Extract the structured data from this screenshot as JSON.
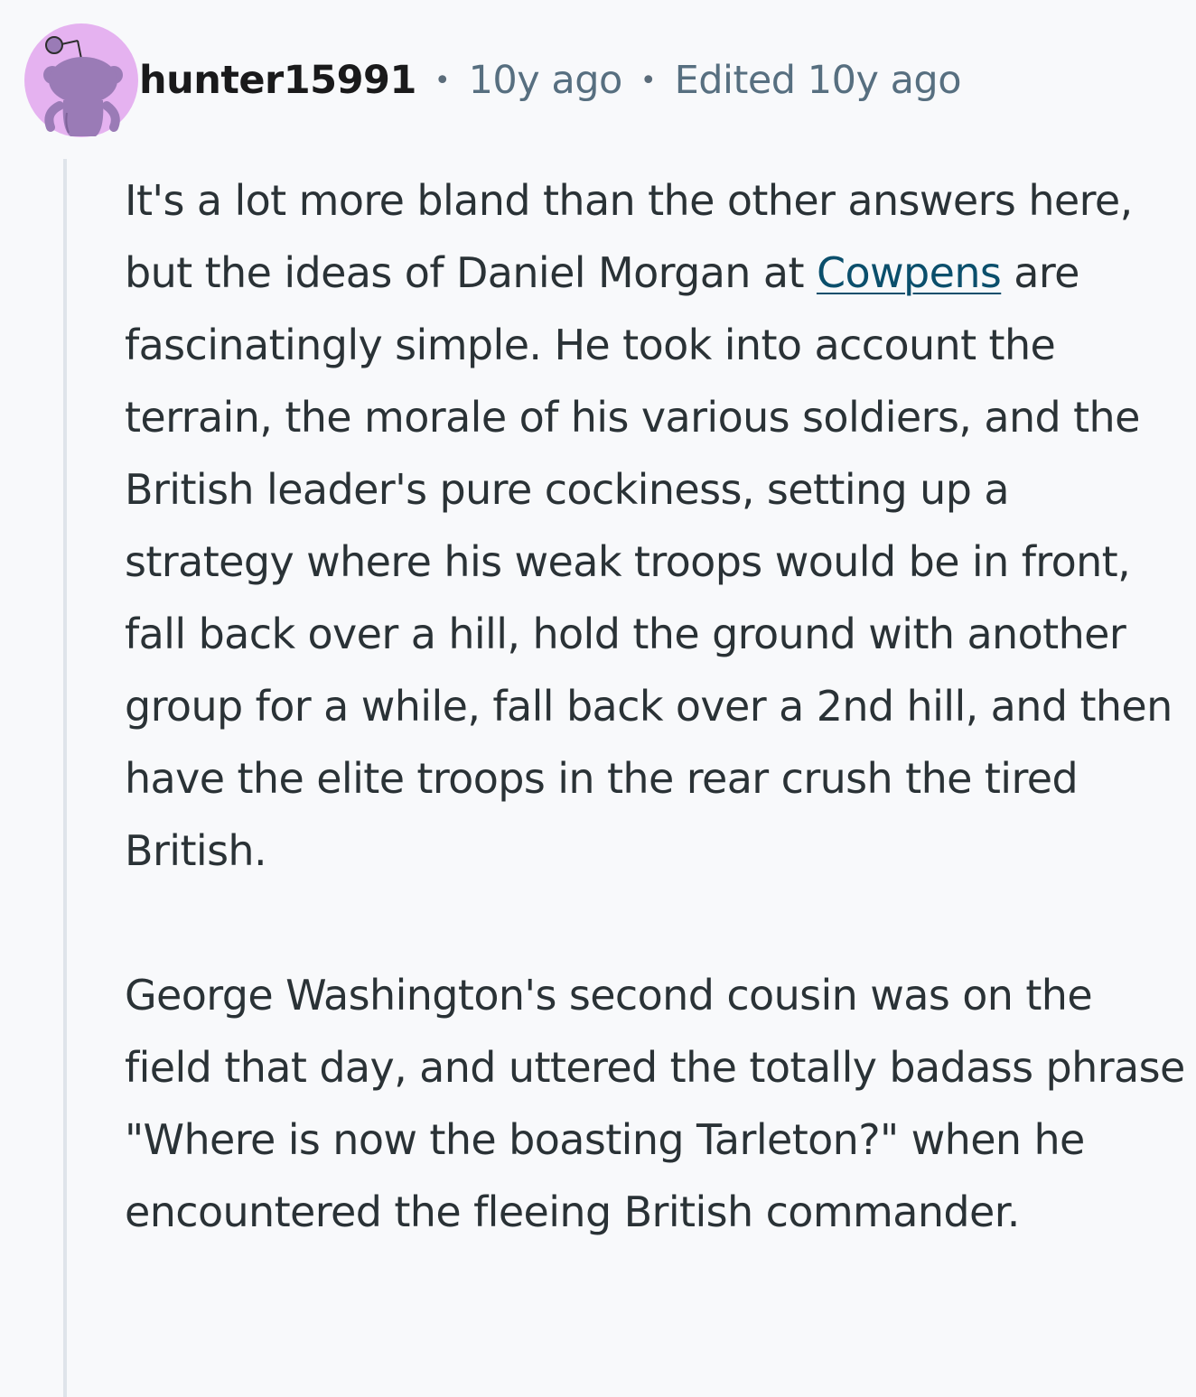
{
  "comment": {
    "author": "hunter15991",
    "time_ago": "10y ago",
    "edited": "Edited 10y ago",
    "separator": "•",
    "body": {
      "p1_before_link": "It's a lot more bland than the other answers here, but the ideas of Daniel Morgan at ",
      "p1_link": "Cowpens",
      "p1_after_link": " are fascinatingly simple. He took into account the terrain, the morale of his various soldiers, and the British leader's pure cockiness, setting up a strategy where his weak troops would be in front, fall back over a hill, hold the ground with another group for a while, fall back over a 2nd hill, and then have the elite troops in the rear crush the tired British.",
      "p2": "George Washington's second cousin was on the field that day, and uttered the totally badass phrase \"Where is now the boasting Tarleton?\" when he encountered the fleeing British commander."
    }
  },
  "colors": {
    "background": "#f8f9fb",
    "avatar_bg": "#e5b2f0",
    "avatar_figure": "#9a7bb6",
    "link": "#0b4f6c",
    "meta_text": "#576f80",
    "thread_line": "#dfe4ea"
  },
  "icons": {
    "avatar": "snoo-avatar-icon"
  }
}
